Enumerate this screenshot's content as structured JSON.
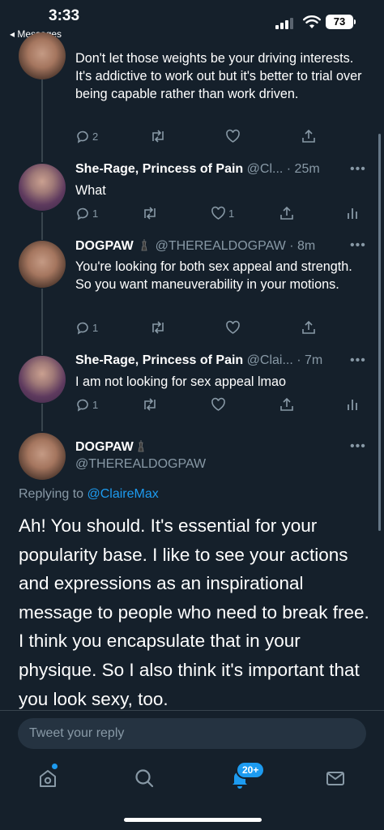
{
  "status": {
    "time": "3:33",
    "back": "◂ Messages",
    "battery": "73"
  },
  "tweets": [
    {
      "body": "Don't let those weights be your driving interests. It's addictive to work out but it's better to trial over being capable rather than work driven.",
      "reply_count": "2",
      "retweet_count": "",
      "like_count": ""
    },
    {
      "name": "She-Rage, Princess of Pain",
      "handle": "@Cl...",
      "time": "· 25m",
      "body": "What",
      "reply_count": "1",
      "retweet_count": "",
      "like_count": "1"
    },
    {
      "name": "DOGPAW",
      "handle": "@THEREALDOGPAW",
      "time": "· 8m",
      "body": "You're looking for both sex appeal and strength. So you want maneuverability in your motions.",
      "reply_count": "1",
      "retweet_count": "",
      "like_count": ""
    },
    {
      "name": "She-Rage, Princess of Pain",
      "handle": "@Clai...",
      "time": "· 7m",
      "body": "I am not looking for sex appeal lmao",
      "reply_count": "1",
      "retweet_count": "",
      "like_count": ""
    }
  ],
  "main": {
    "name": "DOGPAW",
    "handle": "@THEREALDOGPAW",
    "replying_prefix": "Replying to",
    "replying_to": "@ClaireMax",
    "body": "Ah! You should. It's essential for your popularity base. I like to see your actions and expressions as an inspirational message to people who need to break free. I think you encapsulate that in your physique. So I also think it's important that you look sexy, too."
  },
  "reply": {
    "placeholder": "Tweet your reply"
  },
  "tabbar": {
    "notifications_badge": "20+"
  },
  "more_label": "•••",
  "colors": {
    "background": "#15202b",
    "accent": "#1d9bf0",
    "muted": "#8899a6",
    "divider": "#38444d"
  },
  "icons": [
    "reply-icon",
    "retweet-icon",
    "like-icon",
    "share-icon",
    "analytics-icon",
    "home-icon",
    "search-icon",
    "notifications-icon",
    "messages-icon"
  ]
}
